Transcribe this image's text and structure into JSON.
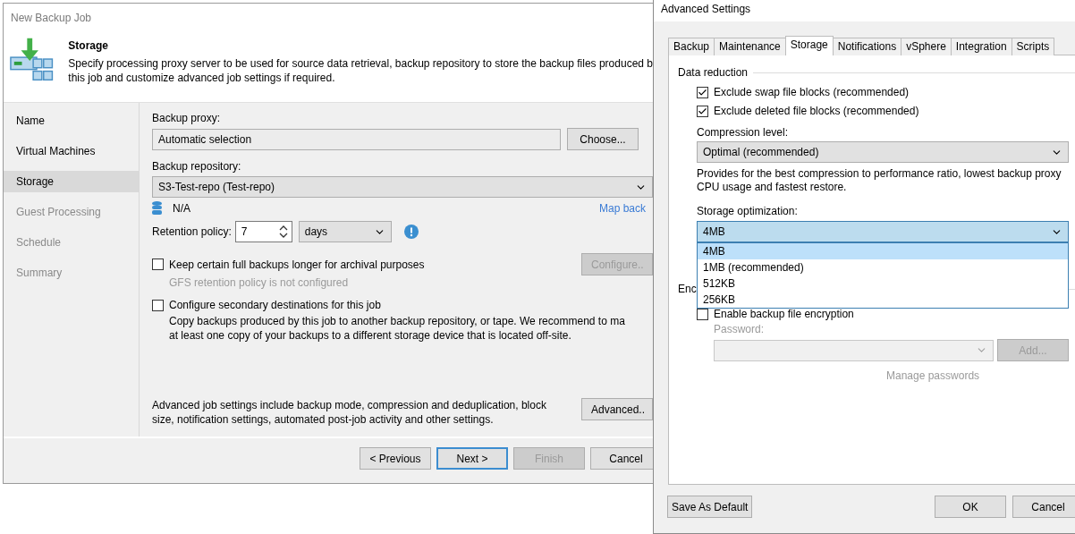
{
  "main_window": {
    "title": "New Backup Job",
    "header": {
      "title": "Storage",
      "description_lines": [
        "Specify processing proxy server to be used for source data retrieval, backup repository to store the backup files produced b",
        "this job and customize advanced job settings if required."
      ]
    },
    "steps": [
      {
        "label": "Name",
        "selected": false,
        "disabled": false
      },
      {
        "label": "Virtual Machines",
        "selected": false,
        "disabled": false
      },
      {
        "label": "Storage",
        "selected": true,
        "disabled": false
      },
      {
        "label": "Guest Processing",
        "selected": false,
        "disabled": true
      },
      {
        "label": "Schedule",
        "selected": false,
        "disabled": true
      },
      {
        "label": "Summary",
        "selected": false,
        "disabled": true
      }
    ],
    "backup_proxy": {
      "label": "Backup proxy:",
      "value": "Automatic selection",
      "button": "Choose..."
    },
    "backup_repository": {
      "label": "Backup repository:",
      "value": "S3-Test-repo (Test-repo)",
      "free_space": "N/A",
      "link": "Map back"
    },
    "retention": {
      "label": "Retention policy:",
      "value": "7",
      "unit": "days"
    },
    "gfs": {
      "label": "Keep certain full backups longer for archival purposes",
      "checked": false,
      "status": "GFS retention policy is not configured",
      "button": "Configure..",
      "button_disabled": true
    },
    "secondary": {
      "label": "Configure secondary destinations for this job",
      "checked": false,
      "description_lines": [
        "Copy backups produced by this job to another backup repository, or tape. We recommend to ma",
        "at least one copy of your backups to a different storage device that is located off-site."
      ]
    },
    "advanced": {
      "description": "Advanced job settings include backup mode, compression and deduplication, block size, notification settings, automated post-job activity and other settings.",
      "button": "Advanced.."
    },
    "footer_buttons": [
      {
        "label": "< Previous",
        "kind": "normal"
      },
      {
        "label": "Next >",
        "kind": "default"
      },
      {
        "label": "Finish",
        "kind": "disabled"
      },
      {
        "label": "Cancel",
        "kind": "normal"
      }
    ]
  },
  "advanced_window": {
    "title": "Advanced Settings",
    "tabs": [
      {
        "label": "Backup",
        "selected": false
      },
      {
        "label": "Maintenance",
        "selected": false
      },
      {
        "label": "Storage",
        "selected": true
      },
      {
        "label": "Notifications",
        "selected": false
      },
      {
        "label": "vSphere",
        "selected": false
      },
      {
        "label": "Integration",
        "selected": false
      },
      {
        "label": "Scripts",
        "selected": false
      }
    ],
    "data_reduction": {
      "label": "Data reduction",
      "options": [
        {
          "label": "Exclude swap file blocks (recommended)",
          "checked": true
        },
        {
          "label": "Exclude deleted file blocks (recommended)",
          "checked": true
        }
      ]
    },
    "compression": {
      "label": "Compression level:",
      "value": "Optimal (recommended)",
      "hint": "Provides for the best compression to performance ratio, lowest backup proxy CPU usage and fastest restore."
    },
    "storage_optimization": {
      "label": "Storage optimization:",
      "value": "4MB",
      "expanded": true,
      "options": [
        {
          "label": "4MB",
          "selected": true
        },
        {
          "label": "1MB (recommended)",
          "selected": false
        },
        {
          "label": "512KB",
          "selected": false
        },
        {
          "label": "256KB",
          "selected": false
        }
      ]
    },
    "encryption": {
      "label": "Enc",
      "option": {
        "label": "Enable backup file encryption",
        "checked": false
      },
      "password_label": "Password:",
      "add_button": "Add...",
      "link": "Manage passwords"
    },
    "buttons": {
      "save_default": "Save As Default",
      "ok": "OK",
      "cancel": "Cancel"
    }
  }
}
